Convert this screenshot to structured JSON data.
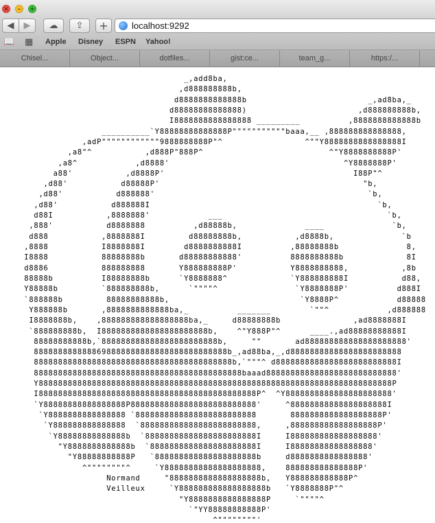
{
  "window": {
    "controls": [
      {
        "name": "close",
        "glyph": "×"
      },
      {
        "name": "minimize",
        "glyph": "–"
      },
      {
        "name": "maximize",
        "glyph": "+"
      }
    ]
  },
  "toolbar": {
    "back_glyph": "◀",
    "forward_glyph": "▶",
    "icloud_glyph": "☁",
    "share_glyph": "⇪",
    "new_tab_glyph": "+",
    "address": "localhost:9292"
  },
  "bookmarks": {
    "reading_list_glyph": "📖",
    "top_sites_glyph": "▦",
    "items": [
      "Apple",
      "Disney",
      "ESPN",
      "Yahoo!"
    ]
  },
  "tabs": [
    "Chisel...",
    "Object...",
    "dotfiles...",
    "gist:ce...",
    "team_g...",
    "https:/..."
  ],
  "page": {
    "ascii_art": "                                      _,add8ba,\n                                     ,d888888888b,\n                                    d8888888888888b                         _,ad8ba,_\n                                   d88888888888888)                       ,d888888888b,\n                                   I8888888888888888 _________          ,8888888888888b\n                     __________`Y88888888888888P\"\"\"\"\"\"\"\"\"\"\"baaa,__ ,888888888888888,\n                 ,adP\"\"\"\"\"\"\"\"\"\"\"\"9888888888P\"^                 ^\"\"Y8888888888888888I\n              ,a8\"^           ,d888P\"888P^                          ^\"Y8888888888P'\n            ,a8^            ,d8888'                                    ^Y8888888P'\n           a88'           ,d8888P'                                       I88P\"^\n         ,d88'           d88888P'                                          \"b,\n        ,d88'           d888888'                                            `b,\n       ,d88'           d888888I                                               `b,\n       d88I           ,8888888'            ___                                  `b,\n      ,888'           d8888888          ,d88888b,              ____              `b,\n      d888           ,8888888I         d88888888b,           ,d8888b,              `b\n     ,8888           I8888888I        d8888888888I          ,88888888b              8,\n     I8888           88888888b       d88888888888'          8888888888b             8I\n     d8886           888888888       Y888888888P'           Y8888888888,           ,8b\n     88888b          I88888888b      `Y8888888^             `Y888888888I           d88,\n     Y88888b         `888888888b,      `\"\"\"\"^                `Y8888888P'          d888I\n     `888888b         88888888888b,                           `Y8888P^            d88888\n      Y888888b       ,8888888888888ba,_          _______        `\"\"^            ,d888888\n      I8888888b,    ,888888888888888888ba,_     d88888888b               ,ad8888888I\n      `888888888b,  I8888888888888888888888b,    ^\"Y888P\"^      ____.,ad88888888888I\n       88888888888b,`888888888888888888888888b,     \"\"       ad888888888888888888888'\n       8888888888888698888888888888888888888888b_,ad88ba,_,d88888888888888888888888\n       88888888888888888888888888888888888888888b,`\"\"\"^ d8888888888888888888888888I\n       8888888888888888888888888888888888888888888baaad888888888888888888888888888'\n       Y8888888888888888888888888888888888888888888888888888888888888888888888888P\n       I888888888888888888888888888888888888888888888P^  ^Y8888888888888888888888'\n       `Y88888888888888888P88888888888888888888888888'     ^88888888888888888888I\n        `Y8888888888888888 `8888888888888888888888888       8888888888888888888P'\n         `Y888888888888888  `888888888888888888888888,     ,888888888888888888P'\n          `Y88888888888888b  `88888888888888888888888I     I888888888888888888'\n            \"Y8888888888888b  `8888888888888888888888I     I88888888888888888'\n              \"Y88888888888P   `888888888888888888888b     d8888888888888888'\n                 ^\"\"\"\"\"\"\"\"^     `Y88888888888888888888,    888888888888888P'\n                      Normand     \"8888888888888888888b,   Y888888888888P^\n                      Veilleux     `Y888888888888888888b   `Y8888888P\"^\n                                     \"Y8888888888888888P     `\"\"\"\"^\n                                       `\"YY88888888888P'\n                                            ^\"\"\"\"\"\"\"\"'"
  }
}
